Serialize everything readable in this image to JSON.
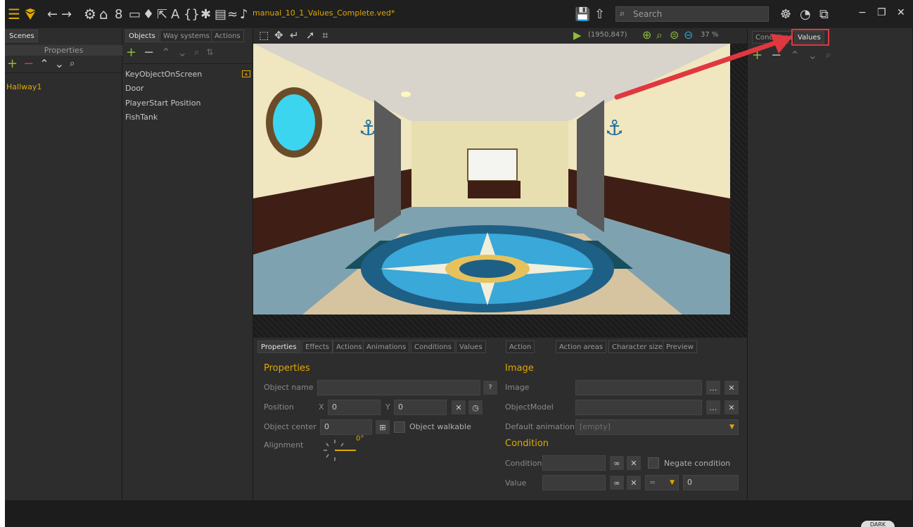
{
  "titlebar": {
    "filename": "manual_10_1_Values_Complete.ved*",
    "search_placeholder": "Search"
  },
  "left_panel": {
    "tab": "Scenes",
    "header": "Properties",
    "items": [
      "Hallway1"
    ]
  },
  "objects_panel": {
    "tabs": [
      "Objects",
      "Way systems",
      "Actions"
    ],
    "items": [
      "KeyObjectOnScreen",
      "Door",
      "PlayerStart Position",
      "FishTank"
    ]
  },
  "canvas_toolbar": {
    "coords": "(1950,847)",
    "zoom": "37 %"
  },
  "right_panel": {
    "tabs": [
      "Conditions",
      "Values"
    ]
  },
  "bottom_tabs_left": [
    "Properties",
    "Effects",
    "Actions",
    "Animations",
    "Conditions",
    "Values"
  ],
  "bottom_tabs_right": [
    "Action",
    "Action areas",
    "Character size",
    "Preview"
  ],
  "properties": {
    "title": "Properties",
    "object_name_label": "Object name",
    "position_label": "Position",
    "x_label": "X",
    "x_value": "0",
    "y_label": "Y",
    "y_value": "0",
    "object_center_label": "Object center",
    "object_center_value": "0",
    "walkable_label": "Object walkable",
    "alignment_label": "Alignment",
    "alignment_value": "0°"
  },
  "image_section": {
    "title": "Image",
    "image_label": "Image",
    "objectmodel_label": "ObjectModel",
    "default_anim_label": "Default animation",
    "default_anim_value": "[empty]"
  },
  "condition_section": {
    "title": "Condition",
    "condition_label": "Condition",
    "negate_label": "Negate condition",
    "value_label": "Value",
    "operator": "=",
    "value": "0"
  },
  "status": {
    "dark_label": "DARK"
  },
  "colors": {
    "accent": "#e0a800",
    "add": "#8fbc3a",
    "remove": "#d23c3c",
    "callout": "#e0383e"
  }
}
